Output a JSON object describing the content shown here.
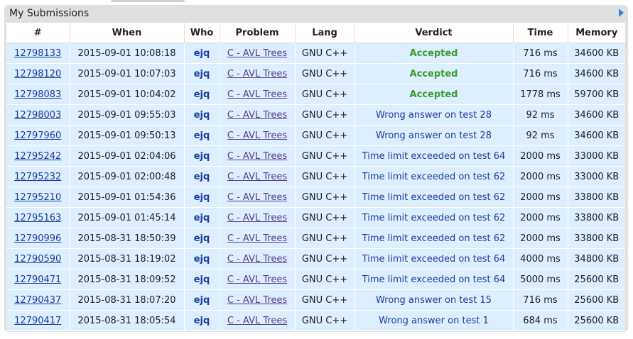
{
  "panel": {
    "title": "My Submissions"
  },
  "columns": [
    "#",
    "When",
    "Who",
    "Problem",
    "Lang",
    "Verdict",
    "Time",
    "Memory"
  ],
  "rows": [
    {
      "id": "12798133",
      "when": "2015-09-01 10:08:18",
      "who": "ejq",
      "problem": "C - AVL Trees",
      "lang": "GNU C++",
      "verdict": "Accepted",
      "accepted": true,
      "time": "716 ms",
      "memory": "34600 KB"
    },
    {
      "id": "12798120",
      "when": "2015-09-01 10:07:03",
      "who": "ejq",
      "problem": "C - AVL Trees",
      "lang": "GNU C++",
      "verdict": "Accepted",
      "accepted": true,
      "time": "716 ms",
      "memory": "34600 KB"
    },
    {
      "id": "12798083",
      "when": "2015-09-01 10:04:02",
      "who": "ejq",
      "problem": "C - AVL Trees",
      "lang": "GNU C++",
      "verdict": "Accepted",
      "accepted": true,
      "time": "1778 ms",
      "memory": "59700 KB"
    },
    {
      "id": "12798003",
      "when": "2015-09-01 09:55:03",
      "who": "ejq",
      "problem": "C - AVL Trees",
      "lang": "GNU C++",
      "verdict": "Wrong answer on test 28",
      "accepted": false,
      "time": "92 ms",
      "memory": "34600 KB"
    },
    {
      "id": "12797960",
      "when": "2015-09-01 09:50:13",
      "who": "ejq",
      "problem": "C - AVL Trees",
      "lang": "GNU C++",
      "verdict": "Wrong answer on test 28",
      "accepted": false,
      "time": "92 ms",
      "memory": "34600 KB"
    },
    {
      "id": "12795242",
      "when": "2015-09-01 02:04:06",
      "who": "ejq",
      "problem": "C - AVL Trees",
      "lang": "GNU C++",
      "verdict": "Time limit exceeded on test 64",
      "accepted": false,
      "time": "2000 ms",
      "memory": "33000 KB"
    },
    {
      "id": "12795232",
      "when": "2015-09-01 02:00:48",
      "who": "ejq",
      "problem": "C - AVL Trees",
      "lang": "GNU C++",
      "verdict": "Time limit exceeded on test 62",
      "accepted": false,
      "time": "2000 ms",
      "memory": "33000 KB"
    },
    {
      "id": "12795210",
      "when": "2015-09-01 01:54:36",
      "who": "ejq",
      "problem": "C - AVL Trees",
      "lang": "GNU C++",
      "verdict": "Time limit exceeded on test 62",
      "accepted": false,
      "time": "2000 ms",
      "memory": "33800 KB"
    },
    {
      "id": "12795163",
      "when": "2015-09-01 01:45:14",
      "who": "ejq",
      "problem": "C - AVL Trees",
      "lang": "GNU C++",
      "verdict": "Time limit exceeded on test 62",
      "accepted": false,
      "time": "2000 ms",
      "memory": "33800 KB"
    },
    {
      "id": "12790996",
      "when": "2015-08-31 18:50:39",
      "who": "ejq",
      "problem": "C - AVL Trees",
      "lang": "GNU C++",
      "verdict": "Time limit exceeded on test 62",
      "accepted": false,
      "time": "2000 ms",
      "memory": "33800 KB"
    },
    {
      "id": "12790590",
      "when": "2015-08-31 18:19:02",
      "who": "ejq",
      "problem": "C - AVL Trees",
      "lang": "GNU C++",
      "verdict": "Time limit exceeded on test 64",
      "accepted": false,
      "time": "4000 ms",
      "memory": "34800 KB"
    },
    {
      "id": "12790471",
      "when": "2015-08-31 18:09:52",
      "who": "ejq",
      "problem": "C - AVL Trees",
      "lang": "GNU C++",
      "verdict": "Time limit exceeded on test 64",
      "accepted": false,
      "time": "5000 ms",
      "memory": "25600 KB"
    },
    {
      "id": "12790437",
      "when": "2015-08-31 18:07:20",
      "who": "ejq",
      "problem": "C - AVL Trees",
      "lang": "GNU C++",
      "verdict": "Wrong answer on test 15",
      "accepted": false,
      "time": "716 ms",
      "memory": "25600 KB"
    },
    {
      "id": "12790417",
      "when": "2015-08-31 18:05:54",
      "who": "ejq",
      "problem": "C - AVL Trees",
      "lang": "GNU C++",
      "verdict": "Wrong answer on test 1",
      "accepted": false,
      "time": "684 ms",
      "memory": "25600 KB"
    }
  ],
  "colors": {
    "accepted": "#3c9d2c",
    "verdict_other": "#1a3f9d",
    "row_background": "#ddeeff",
    "panel_background": "#e0e0e0"
  },
  "icons": {
    "panel_expand": "triangle-right-icon"
  }
}
